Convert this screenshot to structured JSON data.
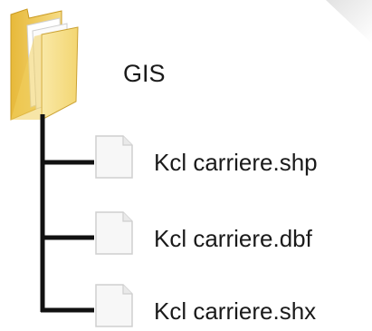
{
  "folder": {
    "icon": "folder-icon",
    "name": "GIS"
  },
  "files": [
    {
      "icon": "file-icon",
      "name": "Kcl carriere.shp"
    },
    {
      "icon": "file-icon",
      "name": "Kcl carriere.dbf"
    },
    {
      "icon": "file-icon",
      "name": "Kcl carriere.shx"
    }
  ],
  "colors": {
    "folder_yellow": "#f2d46b",
    "folder_dark": "#d9aa2a",
    "tree_line": "#111111",
    "text": "#1a1a1a"
  }
}
